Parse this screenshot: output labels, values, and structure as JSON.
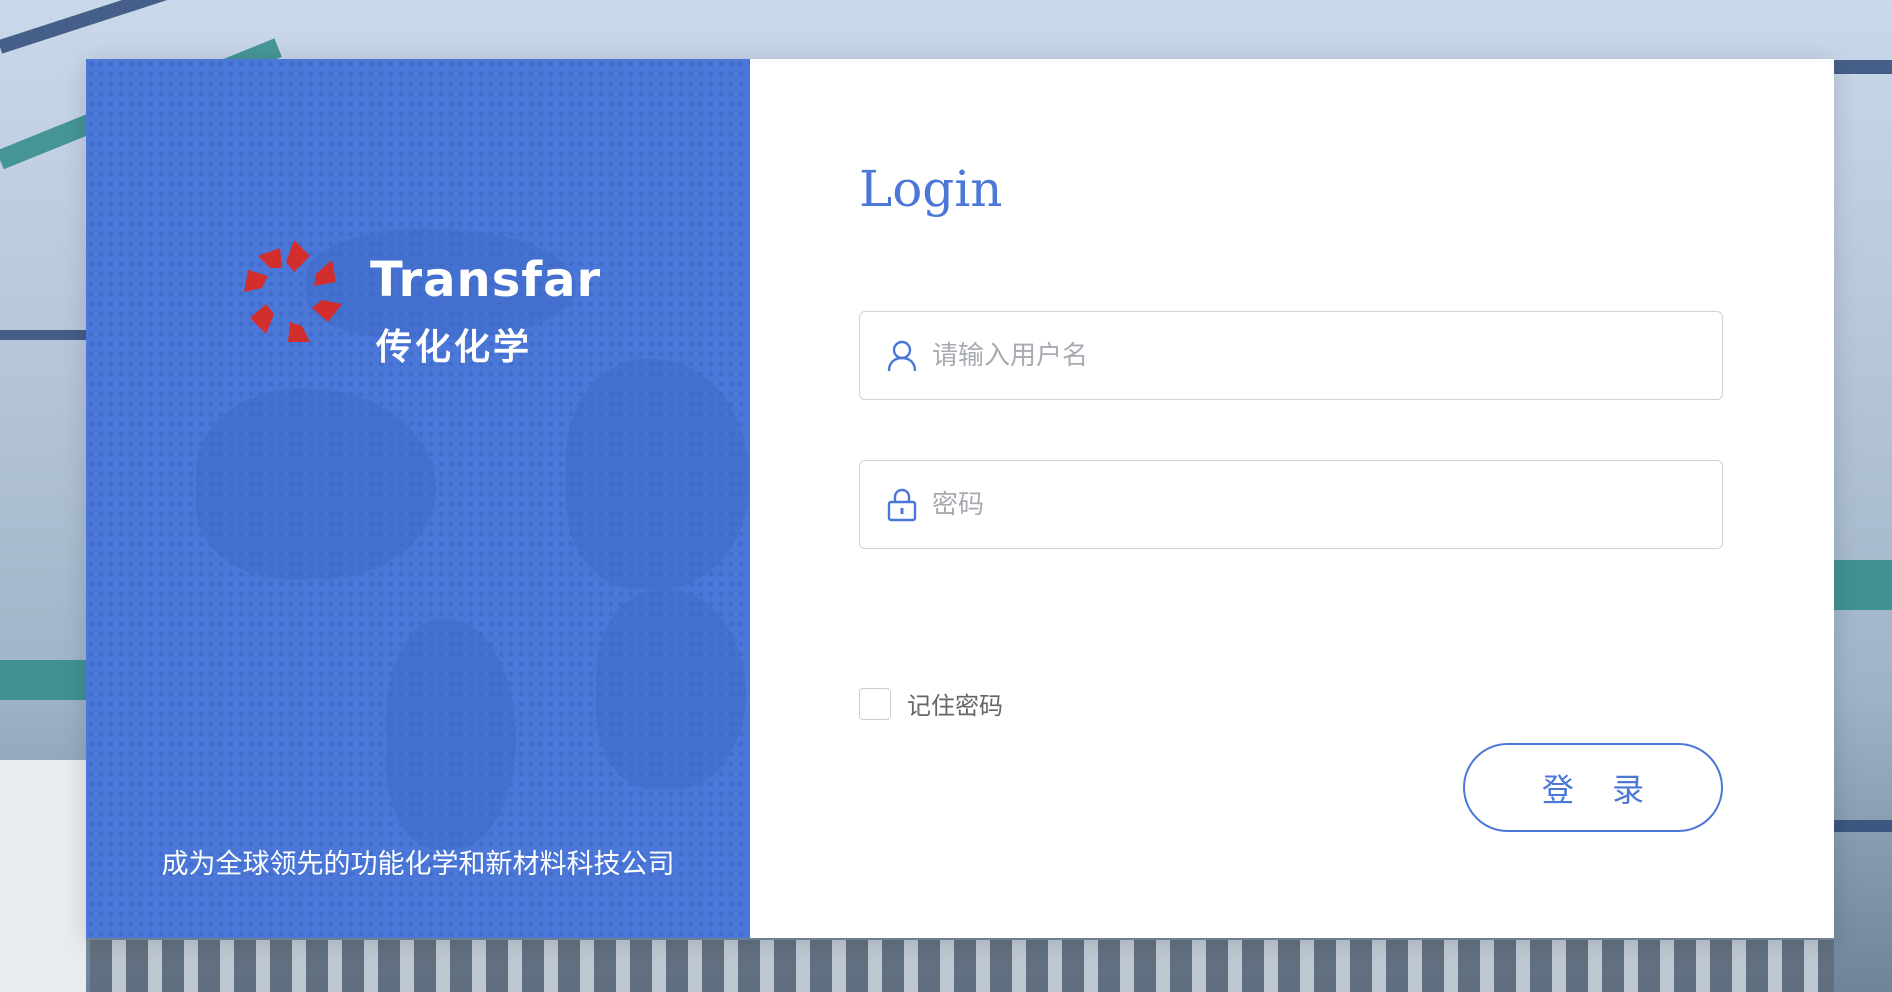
{
  "brand": {
    "name_en": "Transfar",
    "name_cn": "传化化学",
    "logo_icon": "transfar-logo-icon",
    "slogan": "成为全球领先的功能化学和新材料科技公司"
  },
  "login": {
    "title": "Login",
    "username": {
      "placeholder": "请输入用户名",
      "value": "",
      "icon": "user-icon"
    },
    "password": {
      "placeholder": "密码",
      "value": "",
      "icon": "lock-icon"
    },
    "remember_label": "记住密码",
    "remember_checked": false,
    "submit_label": "登 录"
  },
  "colors": {
    "accent": "#4b78d8",
    "logo_red": "#d32e2e"
  }
}
